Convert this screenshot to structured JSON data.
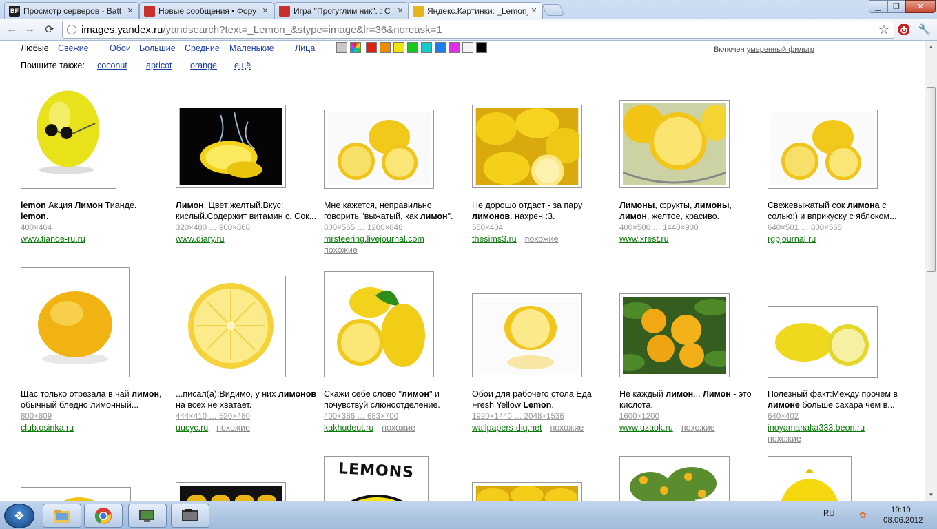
{
  "browser": {
    "tabs": [
      {
        "title": "Просмотр серверов - Batt",
        "favicon": "bf-icon",
        "favtext": "BF",
        "color": "#1f1f1f"
      },
      {
        "title": "Новые сообщения • Фору",
        "favicon": "angry-bird-icon",
        "favtext": "",
        "color": "#c9302c"
      },
      {
        "title": "Игра \"Прогуглим ник\". : С",
        "favicon": "angry-bird-icon",
        "favtext": "",
        "color": "#c9302c"
      },
      {
        "title": "Яндекс.Картинки: _Lemon_",
        "favicon": "yandex-images-icon",
        "favtext": "",
        "color": "#e5b51d"
      }
    ],
    "url_host": "images.yandex.ru",
    "url_path": "/yandsearch?text=_Lemon_&stype=image&lr=36&noreask=1"
  },
  "filters": {
    "items": [
      "Любые",
      "Свежие",
      "Обои",
      "Большие",
      "Средние",
      "Маленькие",
      "Лица"
    ],
    "colors": [
      "#c8c8c8",
      "multicolor",
      "#e31d10",
      "#f08a00",
      "#f3e20b",
      "#18c81a",
      "#17cbcb",
      "#1c7df1",
      "#e02ee8",
      "#f4f4f4",
      "#000000"
    ],
    "family_filter_prefix": "Включен",
    "family_filter_link": "умеренный фильтр"
  },
  "also": {
    "label": "Поищите также:",
    "links": [
      "coconut",
      "apricot",
      "orange",
      "ещё"
    ]
  },
  "results": [
    {
      "desc_html": "<b>lemon</b> Акция <b>Лимон</b> Тианде. <b>lemon</b>.",
      "size": "400×464",
      "site": "www.tiande-ru.ru",
      "similar": "",
      "similar_newline": false
    },
    {
      "desc_html": "<b>Лимон</b>. Цвет:желтый.Вкус: кислый.Содержит витамин с. Сок...",
      "size": "320×480 … 900×868",
      "site": "www.diary.ru",
      "similar": "",
      "similar_newline": false
    },
    {
      "desc_html": "Мне кажется, неправильно говорить \"выжатый, как <b>лимон</b>\".",
      "size": "800×565 … 1200×848",
      "site": "mrsteering.livejournal.com",
      "similar": "похожие",
      "similar_newline": true
    },
    {
      "desc_html": "Не дорошо отдаст - за пару <b>лимонов</b>. нахрен :3.",
      "size": "550×404",
      "site": "thesims3.ru",
      "similar": "похожие",
      "similar_newline": false
    },
    {
      "desc_html": "<b>Лимоны</b>, фрукты, <b>лимоны</b>, <b>лимон</b>, желтое, красиво.",
      "size": "400×500 … 1440×900",
      "site": "www.xrest.ru",
      "similar": "",
      "similar_newline": false
    },
    {
      "desc_html": "Свежевыжатый сок <b>лимона</b> с солью:) и вприкуску с яблоком...",
      "size": "640×501 … 800×565",
      "site": "rgpjournal.ru",
      "similar": "",
      "similar_newline": false
    },
    {
      "desc_html": "Щас только отрезала в чай <b>лимон</b>, обычный бледно лимонный...",
      "size": "800×809",
      "site": "club.osinka.ru",
      "similar": "",
      "similar_newline": false
    },
    {
      "desc_html": "...писал(а):Видимо, у них <b>лимонов</b> на всех не хватает.",
      "size": "444×410 … 520×480",
      "site": "uucyc.ru",
      "similar": "похожие",
      "similar_newline": false
    },
    {
      "desc_html": "Скажи себе слово \"<b>лимон</b>\" и почувствуй слюноотделение.",
      "size": "400×386 … 683×700",
      "site": "kakhudeut.ru",
      "similar": "похожие",
      "similar_newline": false
    },
    {
      "desc_html": "Обои для рабочего стола Еда Fresh Yellow <b>Lemon</b>.",
      "size": "1920×1440 … 2048×1536",
      "site": "wallpapers-diq.net",
      "similar": "похожие",
      "similar_newline": false
    },
    {
      "desc_html": "Не каждый <b>лимон</b>... <b>Лимон</b> - это кислота.",
      "size": "1600×1200",
      "site": "www.uzaok.ru",
      "similar": "похожие",
      "similar_newline": false
    },
    {
      "desc_html": "Полезный факт:Между прочем в <b>лимоне</b> больше сахара чем в...",
      "size": "640×402",
      "site": "inoyamanaka333.beon.ru",
      "similar": "похожие",
      "similar_newline": true
    }
  ],
  "third_row_poster_text": "LEMONS",
  "taskbar": {
    "lang": "RU",
    "time": "19:19",
    "date": "08.06.2012"
  }
}
